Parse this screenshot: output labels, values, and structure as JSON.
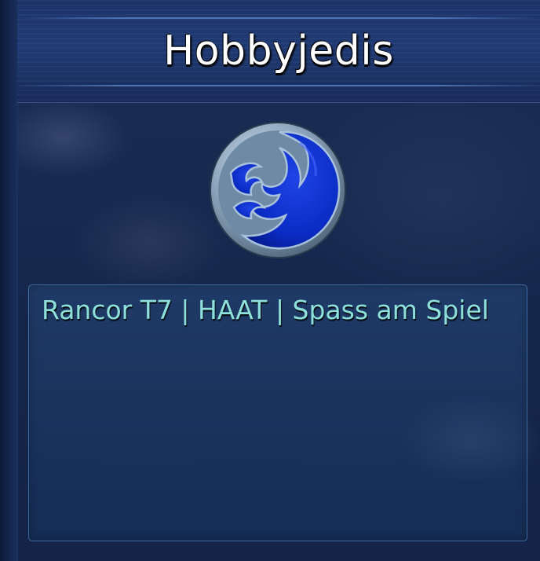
{
  "guild": {
    "name": "Hobbyjedis",
    "emblem_icon": "guild-emblem-icon",
    "description": "Rancor T7 | HAAT | Spass am Spiel"
  },
  "colors": {
    "background": "#14264a",
    "header": "#1f3a74",
    "title_text": "#ffffff",
    "description_text": "#8ee0da",
    "emblem_fill": "#0a2bc4",
    "emblem_rim": "#9fb7cf"
  }
}
